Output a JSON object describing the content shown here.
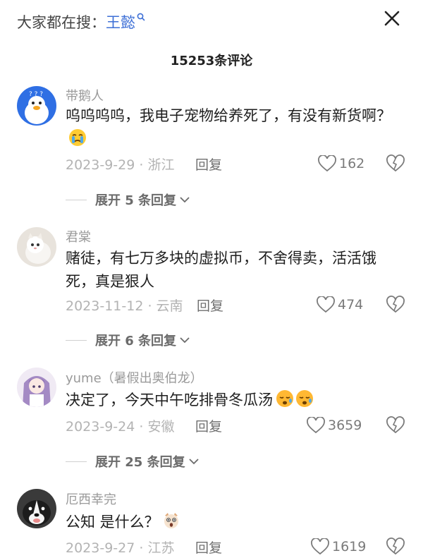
{
  "header": {
    "search_prefix": "大家都在搜：",
    "search_term": "王懿",
    "close_icon": "close-icon"
  },
  "comment_count": "15253条评论",
  "comments": [
    {
      "username": "带鹅人",
      "text": "呜呜呜呜，我电子宠物给养死了，有没有新货啊？",
      "emoji": "crying-face",
      "date": "2023-9-29 · 浙江",
      "reply_label": "回复",
      "likes": "162",
      "expand_label": "展开 5 条回复"
    },
    {
      "username": "君棠",
      "text": "赌徒，有七万多块的虚拟币，不舍得卖，活活饿死，真是狠人",
      "date": "2023-11-12 · 云南",
      "reply_label": "回复",
      "likes": "474",
      "expand_label": "展开 6 条回复"
    },
    {
      "username": "yume（暑假出奥伯龙）",
      "text": "决定了，今天中午吃排骨冬瓜汤",
      "emoji": "sleepy-face",
      "date": "2023-9-24 · 安徽",
      "reply_label": "回复",
      "likes": "3659",
      "expand_label": "展开 25 条回复"
    },
    {
      "username": "厄西幸完",
      "text": "公知 是什么？",
      "emoji": "shocked-cat",
      "date": "2023-9-27 · 江苏",
      "reply_label": "回复",
      "likes": "1619"
    }
  ],
  "colors": {
    "search_term": "#3d6fd6",
    "muted": "#9a9a9a"
  }
}
